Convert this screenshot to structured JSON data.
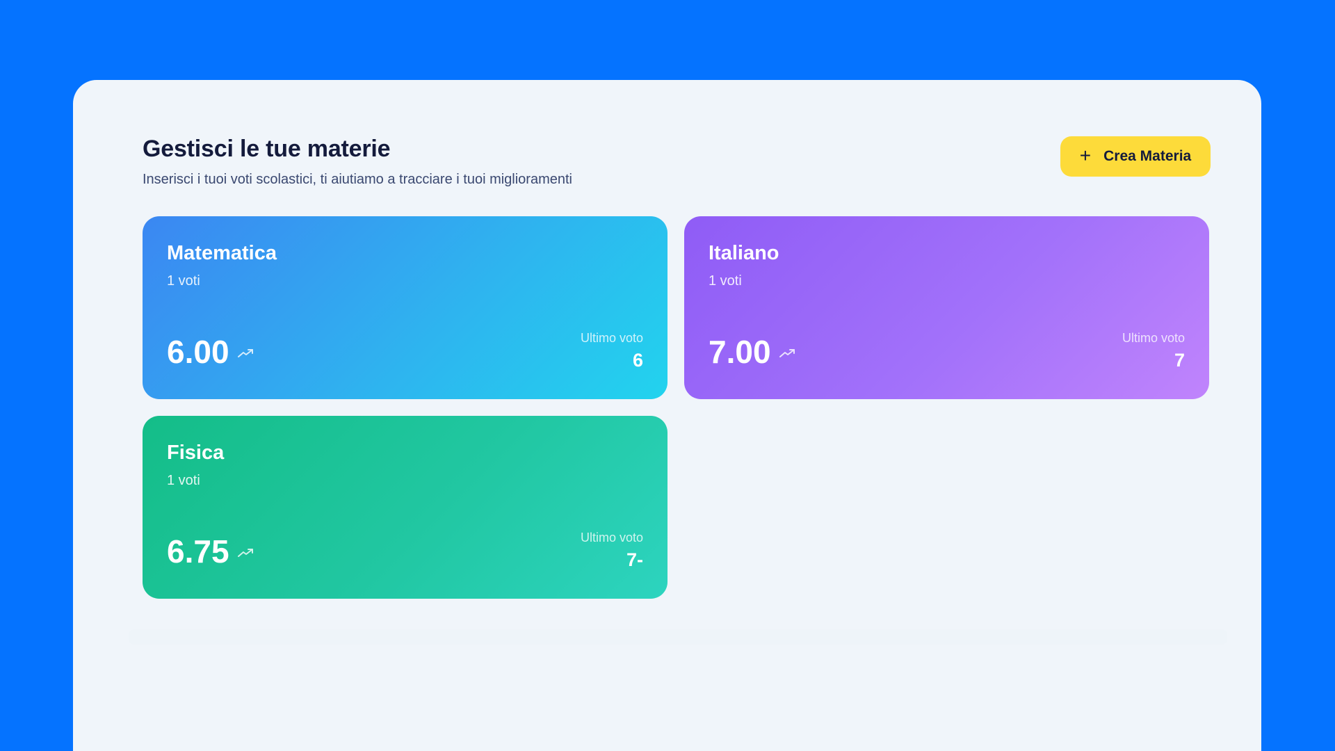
{
  "header": {
    "title": "Gestisci le tue materie",
    "subtitle": "Inserisci i tuoi voti scolastici, ti aiutiamo a tracciare i tuoi miglioramenti",
    "create_button_label": "Crea Materia",
    "create_button_icon": "+"
  },
  "subjects": [
    {
      "name": "Matematica",
      "count": "1 voti",
      "average": "6.00",
      "last_label": "Ultimo voto",
      "last_value": "6",
      "color": "#3b87f2"
    },
    {
      "name": "Italiano",
      "count": "1 voti",
      "average": "7.00",
      "last_label": "Ultimo voto",
      "last_value": "7",
      "color": "#8f5cf6"
    },
    {
      "name": "Fisica",
      "count": "1 voti",
      "average": "6.75",
      "last_label": "Ultimo voto",
      "last_value": "7-",
      "color": "#14bd88"
    }
  ],
  "colors": {
    "background": "#0573ff",
    "panel": "#f0f5fa",
    "button": "#fddb3a",
    "title": "#141b3c"
  }
}
